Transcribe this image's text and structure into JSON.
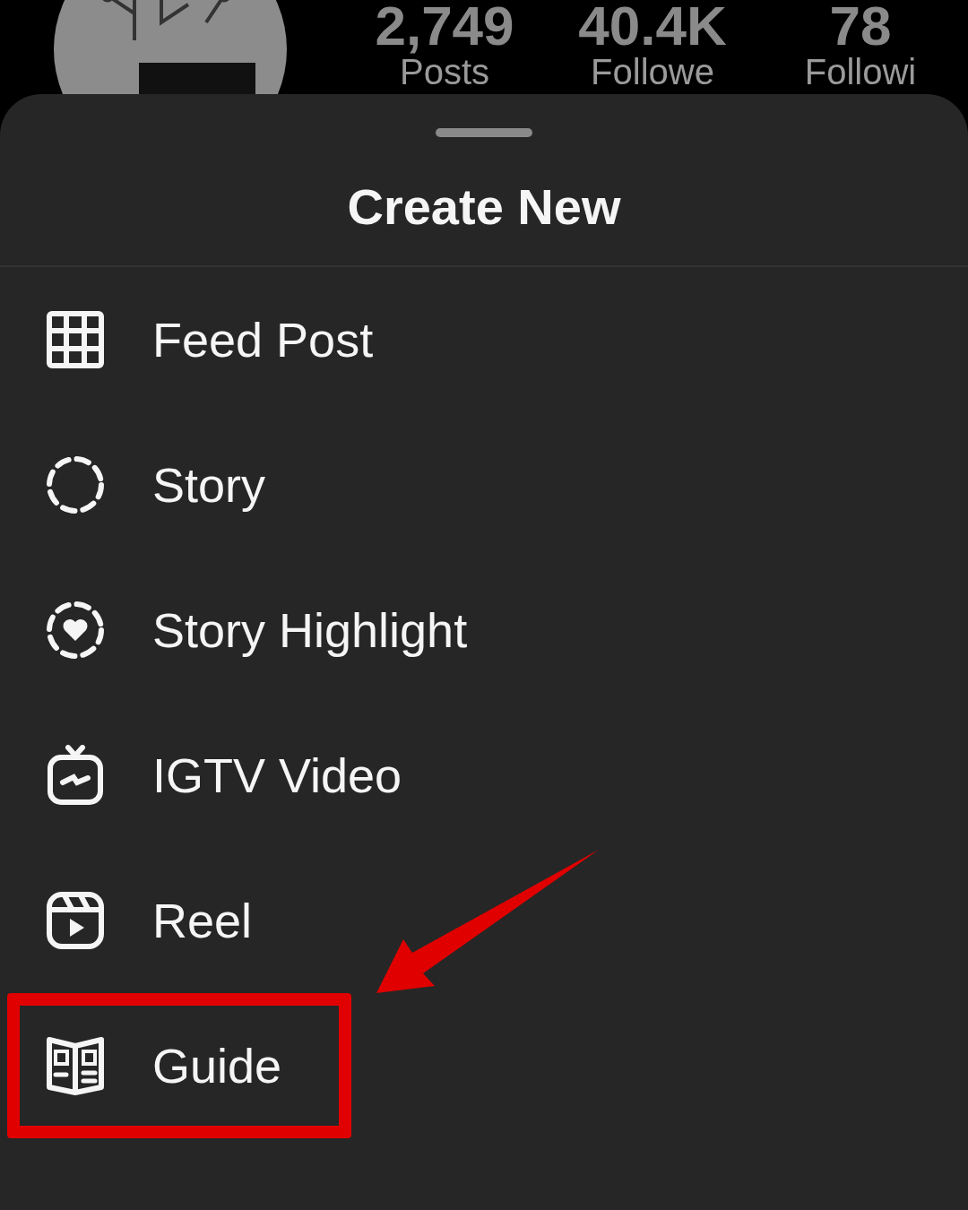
{
  "profile": {
    "stats": [
      {
        "value": "2,749",
        "label": "Posts"
      },
      {
        "value": "40.4K",
        "label": "Followe"
      },
      {
        "value": "78",
        "label": "Followi"
      }
    ]
  },
  "sheet": {
    "title": "Create New",
    "items": [
      {
        "kind": "grid",
        "label": "Feed Post",
        "highlighted": false
      },
      {
        "kind": "story",
        "label": "Story",
        "highlighted": false
      },
      {
        "kind": "highlight",
        "label": "Story Highlight",
        "highlighted": false
      },
      {
        "kind": "tv",
        "label": "IGTV Video",
        "highlighted": false
      },
      {
        "kind": "reel",
        "label": "Reel",
        "highlighted": false
      },
      {
        "kind": "guide",
        "label": "Guide",
        "highlighted": true
      }
    ]
  }
}
